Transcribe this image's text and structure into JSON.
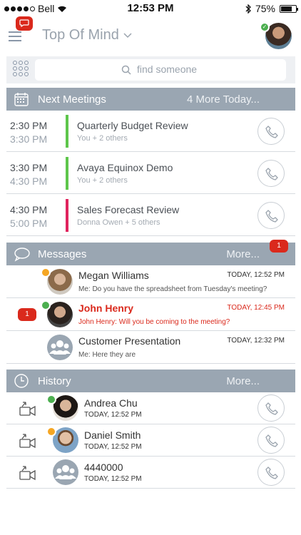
{
  "status_bar": {
    "carrier": "Bell",
    "time": "12:53 PM",
    "battery": "75%",
    "battery_level": 0.75
  },
  "header": {
    "title": "Top Of Mind",
    "menu_icon": "hamburger-icon",
    "chat_icon": "chat-bubble-icon"
  },
  "search": {
    "placeholder": "find someone"
  },
  "meetings_section": {
    "label": "Next Meetings",
    "more": "4 More Today...",
    "icon": "calendar-icon"
  },
  "meetings": [
    {
      "start": "2:30 PM",
      "end": "3:30 PM",
      "title": "Quarterly Budget Review",
      "attendees": "You + 2 others",
      "color": "#5ec64b"
    },
    {
      "start": "3:30 PM",
      "end": "4:30 PM",
      "title": "Avaya Equinox Demo",
      "attendees": "You + 2 others",
      "color": "#5ec64b"
    },
    {
      "start": "4:30 PM",
      "end": "5:00 PM",
      "title": "Sales Forecast Review",
      "attendees": "Donna Owen + 5 others",
      "color": "#e0245e"
    }
  ],
  "messages_section": {
    "label": "Messages",
    "more": "More...",
    "badge": "1",
    "icon": "speech-bubble-icon"
  },
  "messages": [
    {
      "name": "Megan Williams",
      "time": "TODAY, 12:52 PM",
      "preview": "Me: Do you have the spreadsheet from Tuesday's meeting?",
      "presence": "away",
      "unread": false
    },
    {
      "name": "John Henry",
      "time": "TODAY, 12:45 PM",
      "preview": "John Henry: Will you be coming to the meeting?",
      "presence": "available",
      "unread": true,
      "badge": "1"
    },
    {
      "name": "Customer Presentation",
      "time": "TODAY, 12:32 PM",
      "preview": "Me: Here they are",
      "presence": "group",
      "unread": false
    }
  ],
  "history_section": {
    "label": "History",
    "more": "More...",
    "icon": "clock-icon"
  },
  "history": [
    {
      "name": "Andrea Chu",
      "time": "TODAY, 12:52 PM",
      "presence": "available",
      "direction": "outgoing"
    },
    {
      "name": "Daniel Smith",
      "time": "TODAY, 12:52 PM",
      "presence": "away",
      "direction": "outgoing"
    },
    {
      "name": "4440000",
      "time": "TODAY, 12:52 PM",
      "presence": "none",
      "direction": "outgoing"
    }
  ],
  "colors": {
    "accent_red": "#da291c",
    "section_gray": "#9aa6b2",
    "presence_green": "#4caf50",
    "presence_orange": "#f5a623"
  }
}
